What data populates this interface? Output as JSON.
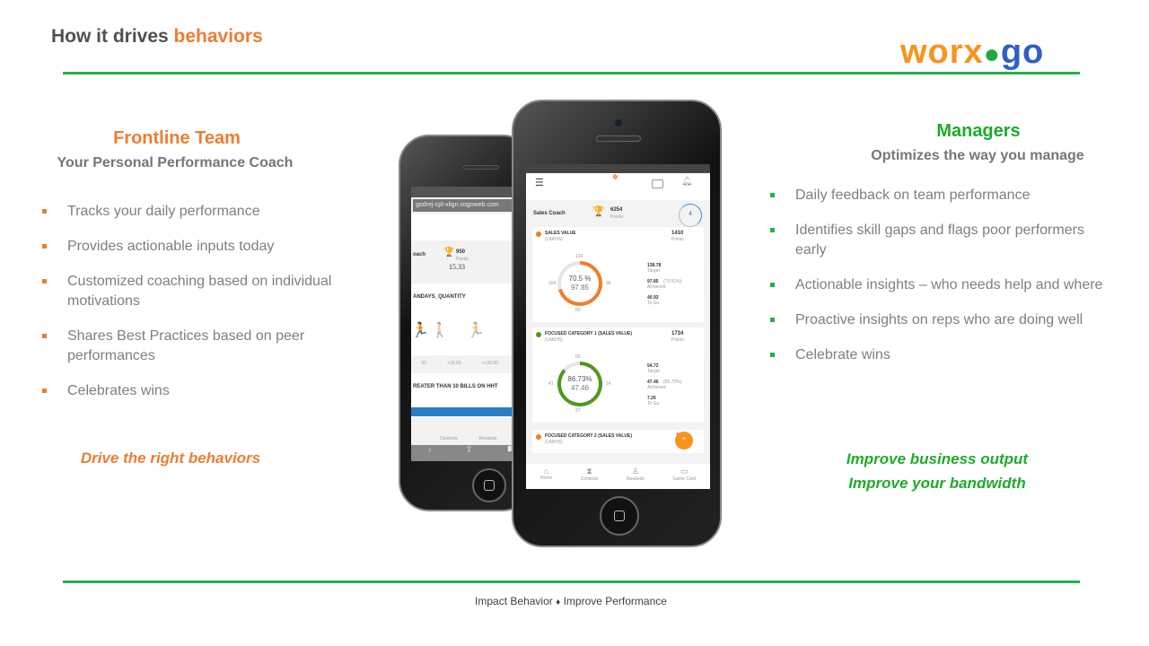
{
  "title": {
    "prefix": "How it drives ",
    "highlight": "behaviors"
  },
  "logo": {
    "part1": "worx",
    "part2": "●",
    "part3": "go",
    "text": "worxogo"
  },
  "left": {
    "heading": "Frontline Team",
    "subheading": "Your Personal Performance Coach",
    "bullets": [
      "Tracks your daily performance",
      "Provides actionable inputs today",
      "Customized coaching based on individual motivations",
      "Shares Best Practices based on peer performances",
      "Celebrates wins"
    ],
    "tagline": "Drive the right behaviors"
  },
  "right": {
    "heading": "Managers",
    "subheading": "Optimizes the way you manage",
    "bullets": [
      "Daily feedback on team performance",
      "Identifies skill gaps and flags poor performers early",
      "Actionable insights – who needs help and where",
      "Proactive insights on reps who are doing well",
      "Celebrate wins"
    ],
    "tagline1": "Improve business output",
    "tagline2": "Improve your bandwidth"
  },
  "footer": {
    "left": "Impact Behavior",
    "sep": "♦",
    "right": "Improve Performance"
  },
  "colors": {
    "orange": "#ED7D31",
    "green": "#22b14c",
    "gray": "#7f7f7f"
  },
  "back_phone": {
    "url": "godrej-cpl-xlign.xogoweb.com",
    "coach": "oach",
    "points": "950",
    "points_label": "Points",
    "value": "15.33",
    "metric1": "ANDAYS_QUANTITY",
    "steps": [
      "00",
      "+15.00",
      "<<20.00",
      ">20"
    ],
    "metric2": "REATER THAN 10 BILLS ON HHT",
    "nav": [
      "Contests",
      "Rewards",
      "Ga"
    ]
  },
  "front_phone": {
    "coach": "Sales Coach",
    "points": "6254",
    "points_label": "Points",
    "badge": "4",
    "cards": [
      {
        "name": "SALES VALUE",
        "unit": "(LAKHS)",
        "pts": "1410",
        "pts_label": "Points",
        "pct": "70.5 %",
        "value": "97.85",
        "top": "139",
        "left": "104",
        "right": "35",
        "bottom": "69",
        "target": "138.78",
        "achieved": "97.85",
        "achieved_pct": "(70.51%)",
        "togo": "40.93",
        "color": "#f07f28",
        "fraction": 0.705
      },
      {
        "name": "FOCUSED CATEGORY 1 (SALES VALUE)",
        "unit": "(LAKHS)",
        "pts": "1734",
        "pts_label": "Points",
        "pct": "86.73%",
        "value": "47.46",
        "top": "55",
        "left": "41",
        "right": "14",
        "bottom": "27",
        "target": "54.72",
        "achieved": "47.46",
        "achieved_pct": "(86.73%)",
        "togo": "7.26",
        "color": "#4e9a1e",
        "fraction": 0.867
      }
    ],
    "card3": {
      "name": "FOCUSED CATEGORY 2 (SALES VALUE)",
      "unit": "(LAKHS)",
      "pts": "1"
    },
    "labels": {
      "target": "Target",
      "achieved": "Achieved",
      "togo": "To Go"
    },
    "nav": [
      "Home",
      "Contests",
      "Rewards",
      "Game Card"
    ]
  }
}
